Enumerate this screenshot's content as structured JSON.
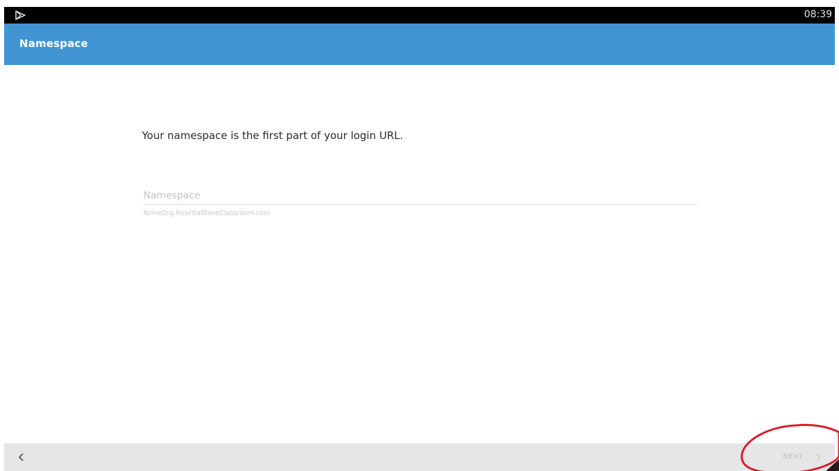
{
  "status_bar": {
    "icon": "play-store-icon",
    "time": "08:39"
  },
  "app_bar": {
    "title": "Namespace",
    "color": "#4295d3"
  },
  "main": {
    "instructions": "Your namespace is the first part of your login URL.",
    "namespace_field": {
      "value": "",
      "placeholder": "Namespace",
      "hint": "AcmeOrg.RosettaStoneClassroom.com"
    }
  },
  "bottom_bar": {
    "back_icon": "chevron-left-icon",
    "next_label": "NEXT",
    "next_icon": "chevron-right-icon"
  },
  "annotation": {
    "shape": "ellipse",
    "color": "#d9202a",
    "target": "next-button"
  }
}
